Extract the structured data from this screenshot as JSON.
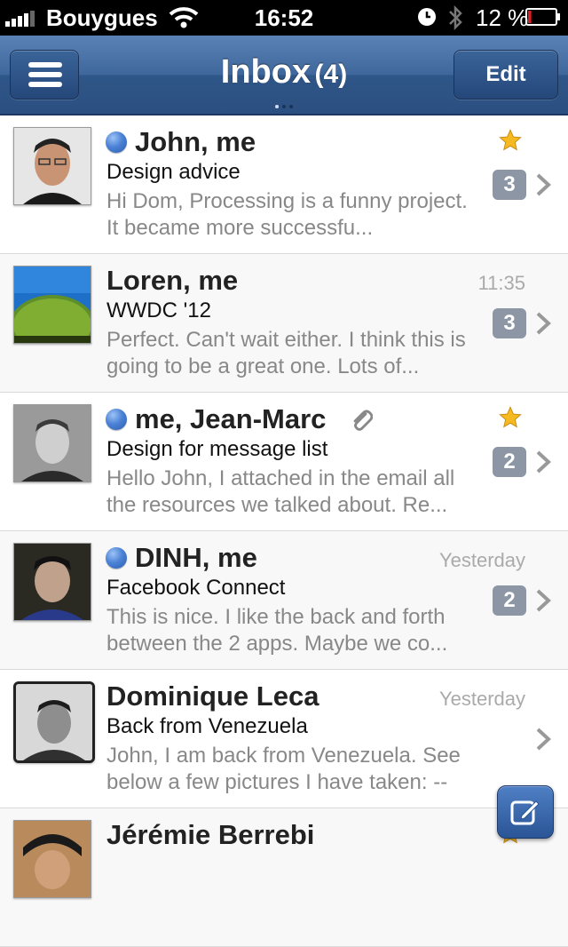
{
  "status_bar": {
    "carrier": "Bouygues",
    "time": "16:52",
    "battery_percent": "12 %",
    "battery_level": 0.12
  },
  "nav": {
    "title": "Inbox",
    "count": "(4)",
    "edit_label": "Edit",
    "menu_icon": "hamburger-menu-icon"
  },
  "messages": [
    {
      "sender": "John, me",
      "subject": "Design advice",
      "preview": "Hi Dom, Processing is a funny project. It became more successfu...",
      "date": "",
      "unread": true,
      "starred": true,
      "attachment": false,
      "count": "3"
    },
    {
      "sender": "Loren, me",
      "subject": "WWDC '12",
      "preview": "Perfect. Can't wait either. I think this is going to be a great one. Lots of...",
      "date": "11:35",
      "unread": false,
      "starred": false,
      "attachment": false,
      "count": "3"
    },
    {
      "sender": "me, Jean-Marc",
      "subject": "Design for message list",
      "preview": "Hello John, I attached in the email all the resources we talked about. Re...",
      "date": "",
      "unread": true,
      "starred": true,
      "attachment": true,
      "count": "2"
    },
    {
      "sender": "DINH, me",
      "subject": "Facebook Connect",
      "preview": "This is nice. I like the back and forth between the 2 apps. Maybe we co...",
      "date": "Yesterday",
      "unread": true,
      "starred": false,
      "attachment": false,
      "count": "2"
    },
    {
      "sender": "Dominique Leca",
      "subject": "Back from Venezuela",
      "preview": "John, I am back from Venezuela. See below a few pictures I have taken: -- D...",
      "date": "Yesterday",
      "unread": false,
      "starred": false,
      "attachment": false,
      "count": ""
    },
    {
      "sender": "Jérémie Berrebi",
      "subject": "",
      "preview": "",
      "date": "",
      "unread": false,
      "starred": true,
      "attachment": false,
      "count": ""
    }
  ],
  "colors": {
    "nav_blue": "#3e679c",
    "unread_dot": "#4c83d6",
    "badge_gray": "#8c96a4",
    "star_gold": "#f5b921"
  }
}
